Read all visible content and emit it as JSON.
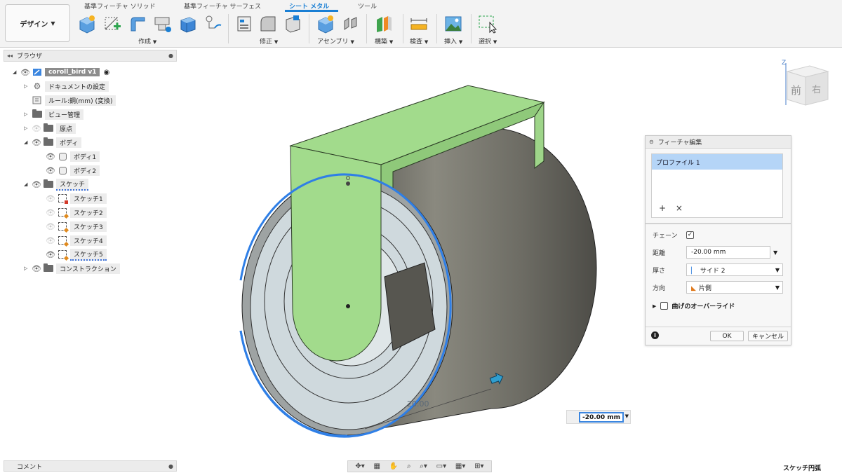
{
  "toolbar": {
    "workspace": "デザイン",
    "tabs": [
      "基準フィーチャ ソリッド",
      "基準フィーチャ サーフェス",
      "シート メタル",
      "ツール"
    ],
    "groups": {
      "create": "作成",
      "modify": "修正",
      "assemble": "アセンブリ",
      "construct": "構築",
      "inspect": "検査",
      "insert": "挿入",
      "select": "選択"
    }
  },
  "browser": {
    "title": "ブラウザ",
    "root": "coroll_bird v1",
    "items": {
      "doc_settings": "ドキュメントの設定",
      "rule": "ルール:鋼(mm) (変換)",
      "view_mgmt": "ビュー管理",
      "origin": "原点",
      "bodies": "ボディ",
      "body1": "ボディ1",
      "body2": "ボディ2",
      "sketches": "スケッチ",
      "sketch1": "スケッチ1",
      "sketch2": "スケッチ2",
      "sketch3": "スケッチ3",
      "sketch4": "スケッチ4",
      "sketch5": "スケッチ5",
      "construction": "コンストラクション"
    }
  },
  "comment": {
    "title": "コメント"
  },
  "viewcube": {
    "front": "前",
    "right": "右",
    "z_axis": "Z"
  },
  "viewport": {
    "dim_label": "20.00"
  },
  "dialog": {
    "title": "フィーチャ編集",
    "profile": "プロファイル 1",
    "chain_label": "チェーン",
    "distance_label": "距離",
    "distance_value": "-20.00 mm",
    "thickness_label": "厚さ",
    "thickness_value": "サイド 2",
    "direction_label": "方向",
    "direction_value": "片側",
    "override_label": "曲げのオーバーライド",
    "ok": "OK",
    "cancel": "キャンセル"
  },
  "dimension_input": "-20.00 mm",
  "status": "スケッチ円弧",
  "colors": {
    "accent": "#1a7fd4",
    "flange": "#a2db8c",
    "cylinder": "#6f6e66",
    "face": "#cfd9dd",
    "selection": "#2f7fe6"
  }
}
